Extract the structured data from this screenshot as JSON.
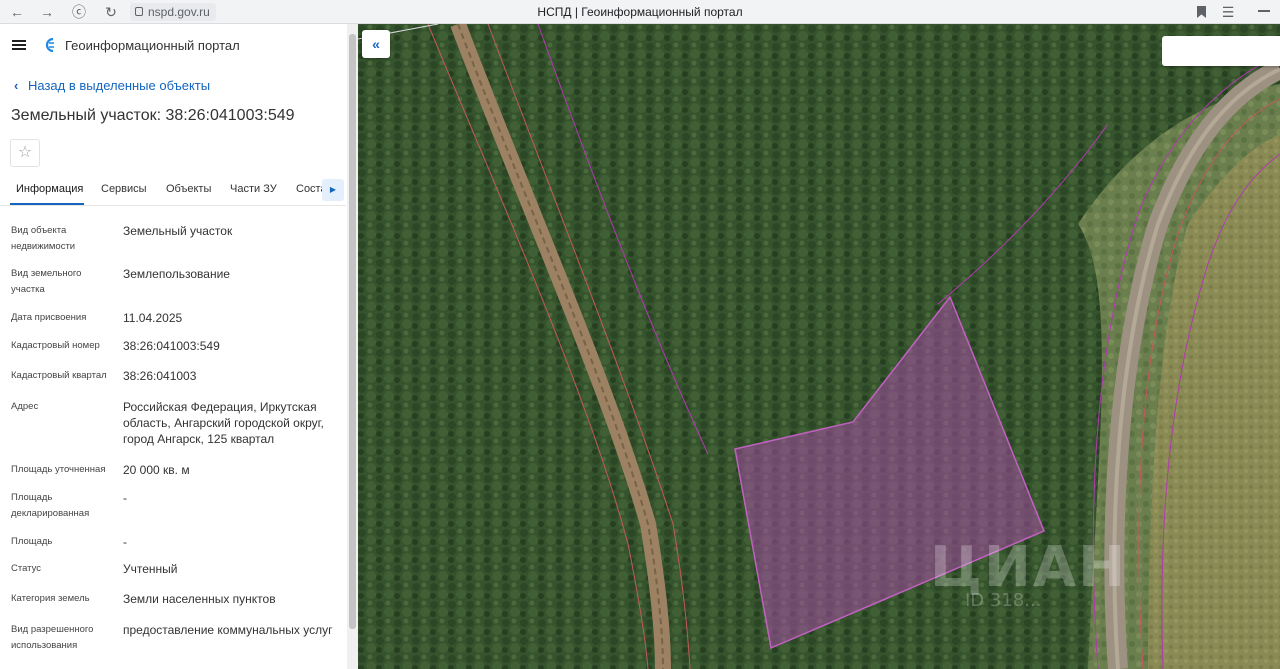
{
  "browser": {
    "url": "nspd.gov.ru",
    "tab_title": "НСПД | Геоинформационный портал"
  },
  "header": {
    "portal_name": "Геоинформационный портал"
  },
  "back_link": "Назад в выделенные объекты",
  "object_title": "Земельный участок: 38:26:041003:549",
  "tabs": [
    {
      "label": "Информация",
      "active": true
    },
    {
      "label": "Сервисы",
      "active": false
    },
    {
      "label": "Объекты",
      "active": false
    },
    {
      "label": "Части ЗУ",
      "active": false
    },
    {
      "label": "Состав",
      "active": false
    }
  ],
  "properties": [
    {
      "label": "Вид объекта недвижимости",
      "value": "Земельный участок"
    },
    {
      "label": "Вид земельного участка",
      "value": "Землепользование"
    },
    {
      "label": "Дата присвоения",
      "value": "11.04.2025"
    },
    {
      "label": "Кадастровый номер",
      "value": "38:26:041003:549"
    },
    {
      "label": "Кадастровый квартал",
      "value": "38:26:041003"
    },
    {
      "label": "Адрес",
      "value": "Российская Федерация, Иркутская область, Ангарский городской округ, город Ангарск, 125 квартал"
    },
    {
      "label": "Площадь уточненная",
      "value": "20 000 кв. м"
    },
    {
      "label": "Площадь декларированная",
      "value": "-"
    },
    {
      "label": "Площадь",
      "value": "-"
    },
    {
      "label": "Статус",
      "value": "Учтенный"
    },
    {
      "label": "Категория земель",
      "value": "Земли населенных пунктов"
    },
    {
      "label": "Вид разрешенного использования",
      "value": "предоставление коммунальных услуг"
    }
  ],
  "map": {
    "parcel_color": "#a64ca6",
    "watermark": "ЦИАН",
    "watermark_id": "ID 318..."
  },
  "colors": {
    "accent": "#1565c0"
  }
}
